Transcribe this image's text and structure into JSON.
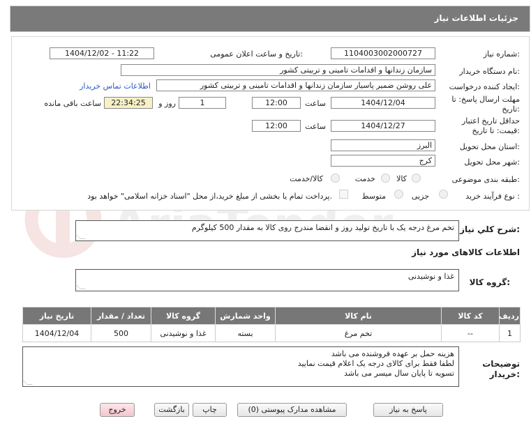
{
  "header": {
    "title": "جزئیات اطلاعات نیاز"
  },
  "fields": {
    "need_number": {
      "label": "شماره نیاز:",
      "value": "1104003002000727"
    },
    "announce_datetime": {
      "label": "تاریخ و ساعت اعلان عمومی:",
      "value": "1404/12/02 - 11:22"
    },
    "buyer_org": {
      "label": "نام دستگاه خریدار:",
      "value": "سازمان زندانها و اقدامات تامینی و تربیتی کشور"
    },
    "requester": {
      "label": "ایجاد کننده درخواست:",
      "value": "علی روشن ضمیر پاسیار سازمان زندانها و اقدامات تامینی و تربیتی کشور"
    },
    "contact_link": "اطلاعات تماس خریدار",
    "deadline": {
      "label": "مهلت ارسال پاسخ: تا تاریخ:",
      "date": "1404/12/04",
      "time_label": "ساعت",
      "time": "12:00",
      "days": "1",
      "days_label": "روز و",
      "remaining": "22:34:25",
      "remaining_label": "ساعت باقی مانده"
    },
    "price_validity": {
      "label": "حداقل تاریخ اعتبار قیمت: تا تاریخ:",
      "date": "1404/12/27",
      "time_label": "ساعت",
      "time": "12:00"
    },
    "province": {
      "label": "استان محل تحویل:",
      "value": "البرز"
    },
    "city": {
      "label": "شهر محل تحویل:",
      "value": "کرج"
    },
    "category": {
      "label": "طبقه بندی موضوعی:",
      "options": [
        "کالا",
        "خدمت",
        "کالا/خدمت"
      ]
    },
    "process": {
      "label": "نوع فرآیند خرید :",
      "options": [
        "جزیی",
        "متوسط"
      ],
      "checkbox_text": "پرداخت تمام یا بخشی از مبلغ خرید،از محل \"اسناد خزانه اسلامی\" خواهد بود."
    }
  },
  "description": {
    "label": "شرح کلي نياز:",
    "value": "تخم مرغ درجه یک با تاریخ تولید روز و انقضا مندرج روی کالا به مقدار 500 کیلوگرم"
  },
  "goods_section": {
    "title": "اطلاعات کالاهای مورد نیاز"
  },
  "goods_group": {
    "label": "گروه کالا:",
    "value": "غذا و نوشیدنی"
  },
  "table": {
    "headers": [
      "ردیف",
      "کد کالا",
      "نام کالا",
      "واحد شمارش",
      "گروه کالا",
      "تعداد / مقدار",
      "تاریخ نیاز"
    ],
    "rows": [
      [
        "1",
        "--",
        "تخم مرغ",
        "بسته",
        "غذا و نوشیدنی",
        "500",
        "1404/12/04"
      ]
    ]
  },
  "buyer_notes": {
    "label": "توضیحات خریدار:",
    "lines": [
      "هزینه حمل بر عهده فروشنده می باشد",
      "لطفا فقط برای کالای درجه یک اعلام قیمت نمایید",
      "تسویه تا پایان سال میسر می باشد"
    ]
  },
  "buttons": {
    "reply": "پاسخ به نیاز",
    "attachments": "مشاهده مدارک پیوستی (0)",
    "print": "چاپ",
    "back": "بازگشت",
    "exit": "خروج"
  },
  "watermark": {
    "text": "AriaTender.net"
  },
  "colors": {
    "header_bg": "#7a7a7a",
    "link": "#2a59c9",
    "remaining_bg": "#f7f1c6",
    "exit_bg": "#f4c6ce"
  }
}
